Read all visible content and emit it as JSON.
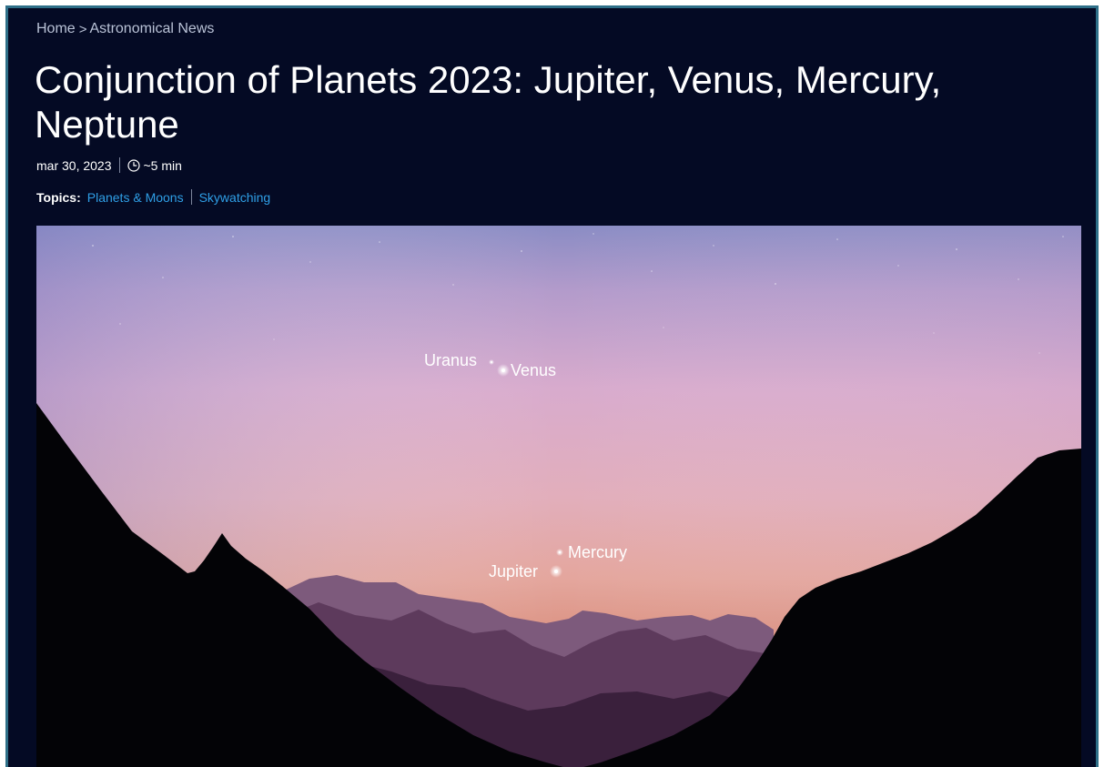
{
  "breadcrumb": {
    "home": "Home",
    "separator": ">",
    "section": "Astronomical News"
  },
  "article": {
    "title": "Conjunction of Planets 2023: Jupiter, Venus, Mercury, Neptune",
    "date": "mar 30, 2023",
    "read_time": "~5 min",
    "topics_label": "Topics:",
    "topics": [
      "Planets & Moons",
      "Skywatching"
    ]
  },
  "hero_image": {
    "labels": {
      "uranus": "Uranus",
      "venus": "Venus",
      "mercury": "Mercury",
      "jupiter": "Jupiter"
    }
  },
  "colors": {
    "page_background": "#040a24",
    "window_border": "#2e6f88",
    "link": "#2f9fe6",
    "breadcrumb": "#b9c2d6",
    "title": "#ffffff"
  },
  "icons": {
    "read_time": "clock-icon",
    "breadcrumb_separator": "chevron-right-icon"
  }
}
